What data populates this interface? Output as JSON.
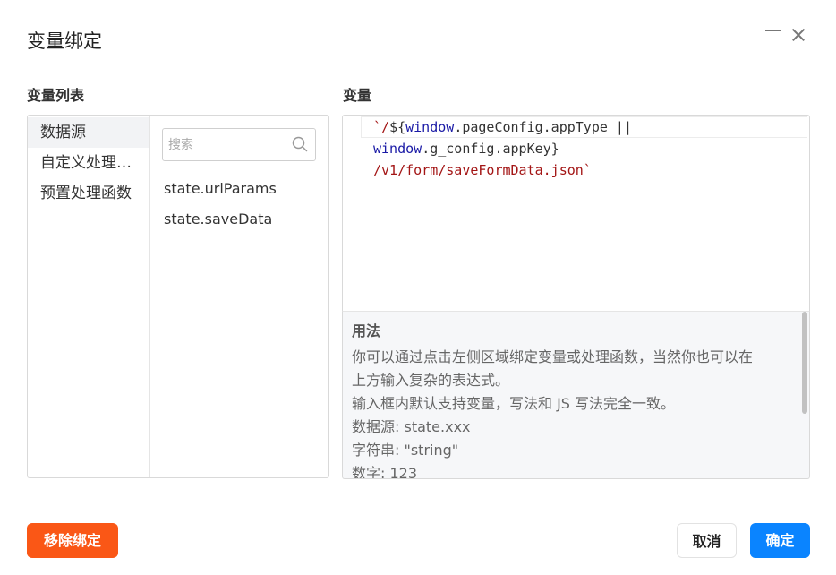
{
  "dialog": {
    "title": "变量绑定"
  },
  "left_panel": {
    "label": "变量列表",
    "categories": [
      {
        "label": "数据源",
        "active": true
      },
      {
        "label": "自定义处理函数",
        "active": false
      },
      {
        "label": "预置处理函数",
        "active": false
      }
    ],
    "search_placeholder": "搜索",
    "variables": [
      "state.urlParams",
      "state.saveData"
    ]
  },
  "right_panel": {
    "label": "变量",
    "code": {
      "l1_a": "`/",
      "l1_b": "${",
      "l1_c": "window",
      "l1_d": ".pageConfig.appType ||",
      "l2_a": "window",
      "l2_b": ".g_config.appKey}",
      "l3_a": "/v1/form/saveFormData.json`"
    },
    "usage": {
      "title": "用法",
      "lines": [
        "你可以通过点击左侧区域绑定变量或处理函数，当然你也可以在",
        "上方输入复杂的表达式。",
        "输入框内默认支持变量，写法和 JS 写法完全一致。",
        "数据源: state.xxx",
        "字符串: \"string\"",
        "数字: 123"
      ]
    }
  },
  "footer": {
    "unbind_label": "移除绑定",
    "cancel_label": "取消",
    "ok_label": "确定"
  },
  "colors": {
    "unbind": "#fa5716",
    "primary": "#0a84ff",
    "code_string": "#a31515",
    "code_variable": "#1a1aa6"
  }
}
